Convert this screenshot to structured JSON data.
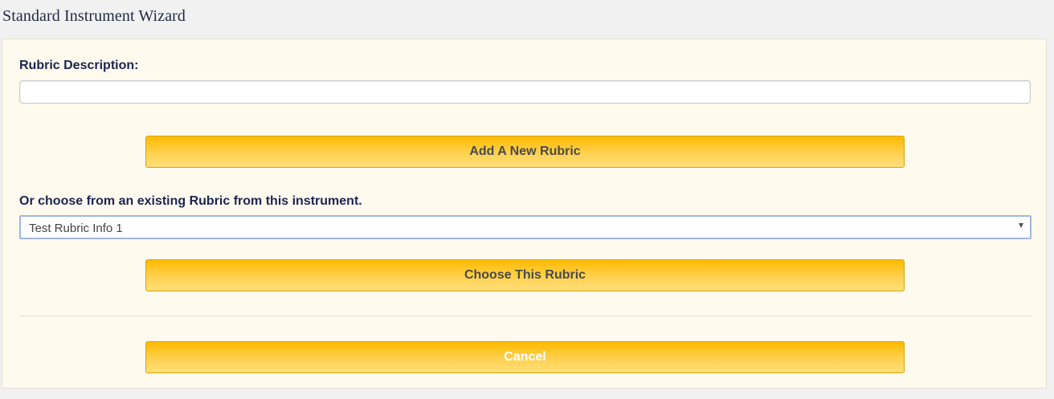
{
  "header": {
    "title": "Standard Instrument Wizard"
  },
  "form": {
    "description_label": "Rubric Description:",
    "description_value": "",
    "add_button_label": "Add A New Rubric",
    "existing_label": "Or choose from an existing Rubric from this instrument.",
    "existing_selected": "Test Rubric Info 1",
    "choose_button_label": "Choose This Rubric",
    "cancel_button_label": "Cancel"
  },
  "colors": {
    "button_gradient_top": "#ffba00",
    "button_gradient_bottom": "#ffdf7a",
    "panel_background": "#fffaee",
    "label_text": "#1b2550"
  },
  "icons": {
    "select_arrow": "chevron-down-icon"
  }
}
